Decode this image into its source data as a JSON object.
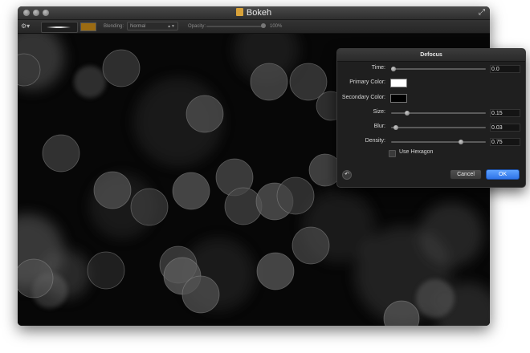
{
  "window": {
    "title": "Bokeh",
    "traffic_lights": [
      "close",
      "minimize",
      "zoom"
    ],
    "fullscreen_icon": "expand-arrows-icon"
  },
  "toolbar": {
    "gear_icon": "gear-icon",
    "blending_label": "Blending:",
    "blending_value": "Normal",
    "opacity_label": "Opacity:",
    "opacity_value": "100%",
    "color_well": "#9b6b12"
  },
  "dialog": {
    "title": "Defocus",
    "time_label": "Time:",
    "time_value": "0.0",
    "time_fraction": 0.0,
    "primary_color_label": "Primary Color:",
    "primary_color": "#ffffff",
    "secondary_color_label": "Secondary Color:",
    "secondary_color": "#000000",
    "size_label": "Size:",
    "size_value": "0.15",
    "size_fraction": 0.15,
    "blur_label": "Blur:",
    "blur_value": "0.03",
    "blur_fraction": 0.03,
    "density_label": "Density:",
    "density_value": "0.75",
    "density_fraction": 0.75,
    "use_hexagon_label": "Use Hexagon",
    "use_hexagon_checked": false,
    "cancel_label": "Cancel",
    "ok_label": "OK",
    "reset_icon": "reset-icon"
  }
}
